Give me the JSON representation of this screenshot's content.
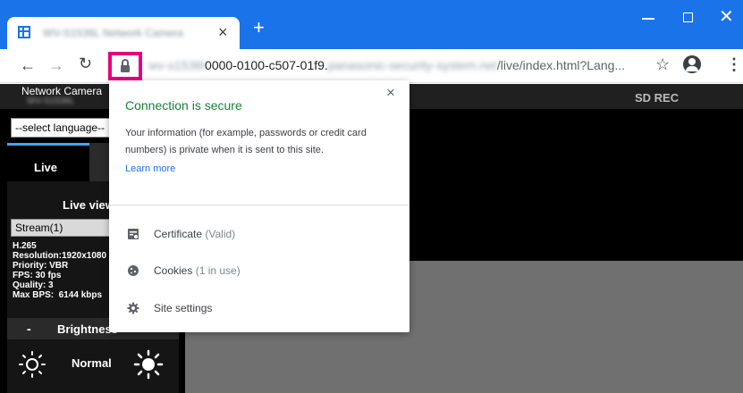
{
  "browser": {
    "tab_title": "WV-S1536L Network Camera",
    "tab_close": "×",
    "new_tab": "+",
    "url_visible_start": "0000-0100-c507-01f9.",
    "url_blurred_host": "panasonic-security-system.net",
    "url_path": "/live/index.html?Lang...",
    "url_prefix_blurred": "wv-s1536l"
  },
  "popup": {
    "close": "×",
    "title": "Connection is secure",
    "description": "Your information (for example, passwords or credit card numbers) is private when it is sent to this site.",
    "learn_more": "Learn more",
    "items": [
      {
        "label": "Certificate",
        "note": "(Valid)",
        "icon": "certificate-icon"
      },
      {
        "label": "Cookies",
        "note": "(1 in use)",
        "icon": "cookie-icon"
      },
      {
        "label": "Site settings",
        "note": "",
        "icon": "gear-icon"
      }
    ]
  },
  "camera": {
    "title": "Network Camera",
    "model": "WV-S1536L",
    "sd_rec": "SD REC",
    "language_select": "--select language--",
    "live_tab": "Live",
    "live_view_label": "Live view",
    "stream_select": "Stream(1)",
    "stream_info": "H.265\nResolution:1920x1080\nPriority: VBR\nFPS: 30 fps\nQuality: 3\nMax BPS:  6144 kbps",
    "brightness_minus": "-",
    "brightness_label": "Brightness",
    "brightness_value": "Normal"
  }
}
